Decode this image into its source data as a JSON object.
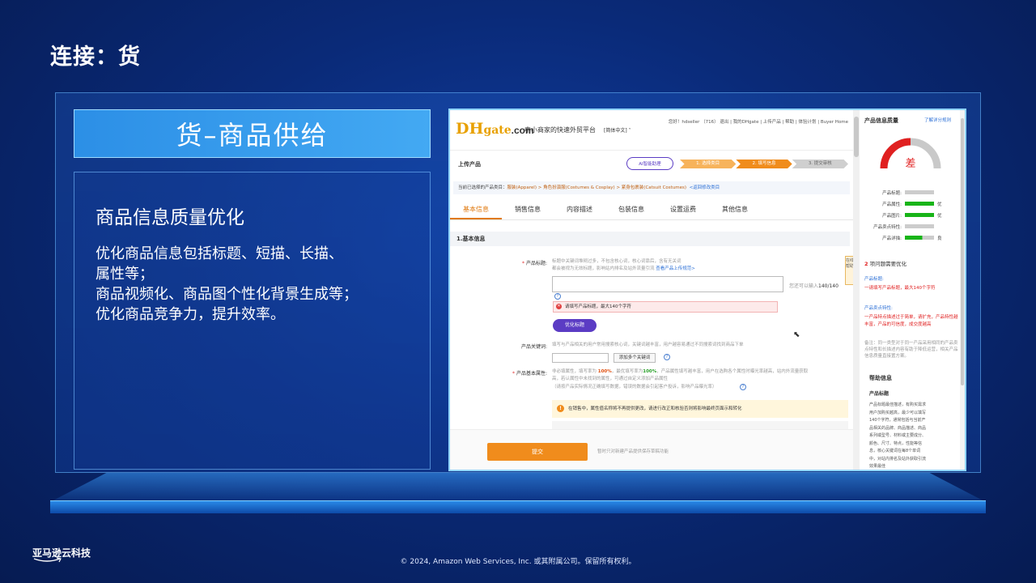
{
  "slide": {
    "title": "连接：货",
    "hero": "货–商品供给",
    "heading": "商品信息质量优化",
    "lines": [
      "优化商品信息包括标题、短描、长描、",
      "属性等；",
      "商品视频化、商品图个性化背景生成等；",
      "优化商品竞争力，提升效率。"
    ],
    "footer_logo": "亚马逊云科技",
    "copyright": "© 2024, Amazon Web Services, Inc. 或其附属公司。保留所有权利。"
  },
  "app": {
    "logo_dh": "DH",
    "logo_gate": "gate",
    "logo_com": ".com",
    "slogan": "中小商家的快速外贸平台",
    "language": "[简体中文] ˅",
    "toplinks": "您好！hdseller （716） 退出 | 我的DHgate | 上传产品 | 帮助 | 体验计划 | Buyer Home",
    "upload_title": "上传产品",
    "ai_button": "AI智能助理",
    "steps": [
      "1. 选择类目",
      "2. 填写信息",
      "3. 提交审核"
    ],
    "category_prefix": "当前已选择的产品类目：",
    "category_path": "服装(Apparel) > 角色扮演服(Costumes & Cosplay) > 紧身包裹装(Catsuit Costumes)",
    "category_back": "<返回修改类目",
    "tabs": [
      "基本信息",
      "销售信息",
      "内容描述",
      "包装信息",
      "设置运费",
      "其他信息"
    ],
    "section_title": "1.基本信息",
    "title_label": "产品标题:",
    "title_hint1": "标题中关键词堆砌过多，不包含核心词，核心词靠后，含有无关词",
    "title_hint2_a": "都会被视为无效标题，影响站内排名及站外流量引流  ",
    "title_hint2_b": "查看产品上传规范>",
    "title_counter_a": "您还可以输入",
    "title_counter_b": "140/140",
    "error_text": "请填写产品标题，最大140个字符",
    "optimize_button": "优化标题",
    "keyword_label": "产品关键词:",
    "keyword_hint": "填写与产品相关的用户常用搜索核心词，关键词越丰富，用户越容易通过不同搜索词找到商品下单",
    "add_keyword_button": "添加多个关键词",
    "attr_label": "产品基本属性:",
    "attr_hint1_a": "非必填属性，填写率为 ",
    "attr_hint1_b": "100%",
    "attr_hint1_c": "，最优填写率为",
    "attr_hint1_d": "100%",
    "attr_hint1_e": "，产品属性填写越丰富，用户在选购各个属性时曝光率越高，站内外流量获取",
    "attr_hint2": "高，若认属性中未找到的属性，可通过自定义添加产品属性",
    "attr_hint3": "（请按产品实际情况正确填写数据，错误的数据会引起客户投诉，影响产品曝光率）",
    "notice": "在销售中，属性值名称将不再提供更改，请进行改正和核验否则将影响最终页面示和转化",
    "submit_button": "提交",
    "submit_note": "暂时只对新建产品提供保存草稿功能",
    "float_help": "在线帮助",
    "quality": {
      "title": "产品信息质量",
      "link": "了解详分规则",
      "grade": "差",
      "metrics": [
        {
          "label": "产品标题:",
          "level": 0,
          "value": ""
        },
        {
          "label": "产品属性:",
          "level": 1,
          "value": "优"
        },
        {
          "label": "产品图片:",
          "level": 1,
          "value": "优"
        },
        {
          "label": "产品卖点特性:",
          "level": 0,
          "value": ""
        },
        {
          "label": "产品详描:",
          "level": 0.6,
          "value": "良"
        }
      ],
      "issues_count": "2",
      "issues_label": "项问题需要优化",
      "issue1_head": "产品标题:",
      "issue1_text": "一请填写产品标题，最大140个字符",
      "issue2_head": "产品卖点特性:",
      "issue2_text": "一产品特点描述过于简单，请扩充，产品特性越丰富，产品的可信度，成交度越高",
      "note": "备注：同一类型对于同一产品采用相同的产品卖点特性和长描述内容有助于降低运营，相关产品信息质量直接置方案。",
      "help_title": "帮助信息",
      "help_sub": "产品标题",
      "help_text": "产品标题最佳描述，有购买需求用户加购买越高，最少可以填写140个字符，通常包括与当前产品相关的品牌、商品描述、商品系列或型号、材料或主要成分、颜色、尺寸、特点，性能等信息，核心关键词在每8个单词中，对站内排名及站外获取引流效果最佳"
    }
  }
}
